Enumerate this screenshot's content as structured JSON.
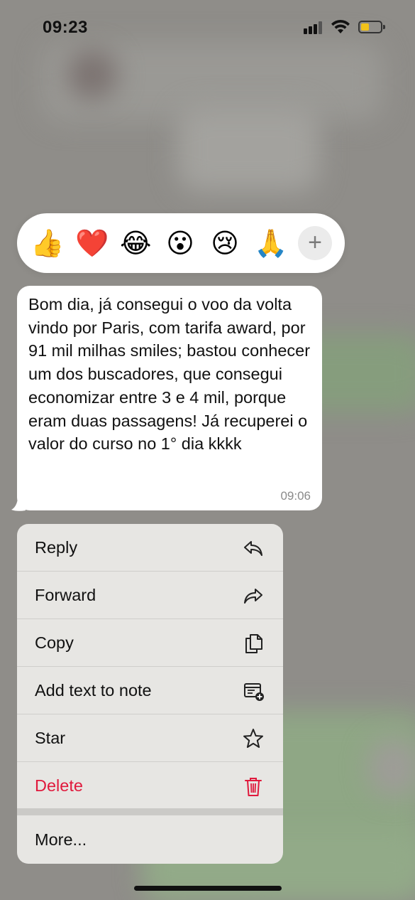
{
  "status_bar": {
    "time": "09:23",
    "battery_color": "#f2c21a"
  },
  "reactions": [
    {
      "name": "thumbs-up",
      "emoji": "👍"
    },
    {
      "name": "red-heart",
      "emoji": "❤️"
    },
    {
      "name": "face-with-tears-of-joy",
      "emoji": "😂"
    },
    {
      "name": "surprised-face",
      "emoji": "😮"
    },
    {
      "name": "crying-face",
      "emoji": "😢"
    },
    {
      "name": "folded-hands",
      "emoji": "🙏"
    }
  ],
  "reactions_more_symbol": "+",
  "message": {
    "text": "Bom dia, já consegui o voo da volta vindo por Paris, com tarifa award, por 91 mil milhas smiles; bastou conhecer um dos buscadores, que consegui economizar entre 3 e 4 mil, porque eram duas passagens! Já recuperei o valor do curso no 1° dia kkkk",
    "time": "09:06"
  },
  "menu": {
    "reply": "Reply",
    "forward": "Forward",
    "copy": "Copy",
    "add_to_note": "Add text to note",
    "star": "Star",
    "delete": "Delete",
    "more": "More..."
  },
  "colors": {
    "delete": "#e0193c",
    "menu_bg": "#e7e6e3"
  }
}
